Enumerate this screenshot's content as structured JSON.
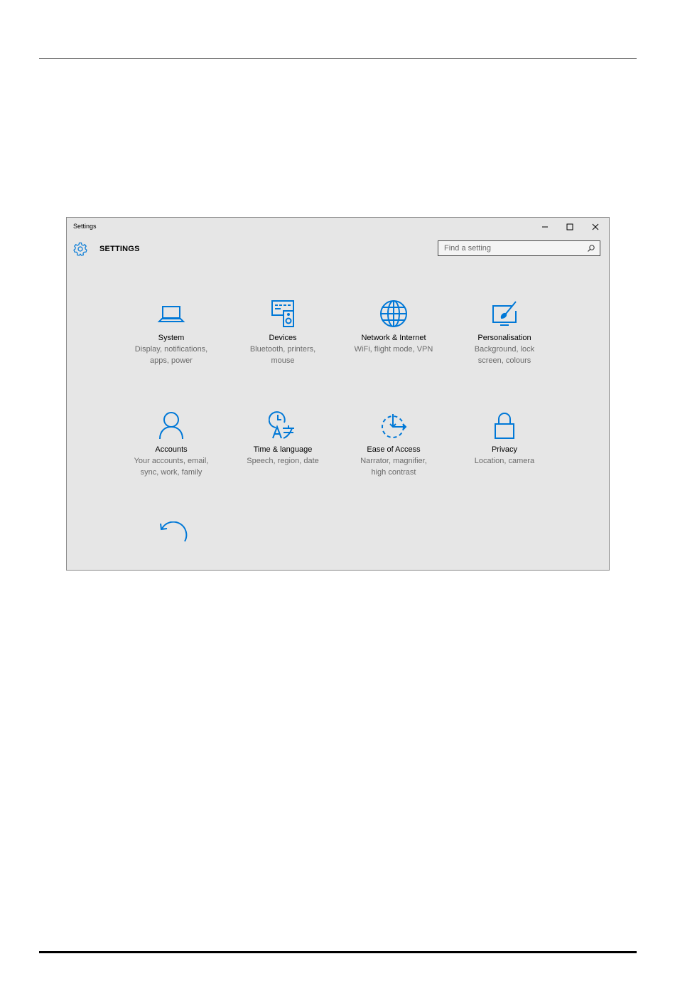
{
  "window": {
    "title": "Settings",
    "heading": "SETTINGS",
    "search": {
      "placeholder": "Find a setting",
      "value": ""
    }
  },
  "tiles": [
    {
      "title": "System",
      "desc1": "Display, notifications,",
      "desc2": "apps, power",
      "icon": "laptop-icon"
    },
    {
      "title": "Devices",
      "desc1": "Bluetooth, printers,",
      "desc2": "mouse",
      "icon": "devices-icon"
    },
    {
      "title": "Network & Internet",
      "desc1": "WiFi, flight mode, VPN",
      "desc2": "",
      "icon": "globe-icon"
    },
    {
      "title": "Personalisation",
      "desc1": "Background, lock",
      "desc2": "screen, colours",
      "icon": "paint-icon"
    },
    {
      "title": "Accounts",
      "desc1": "Your accounts, email,",
      "desc2": "sync, work, family",
      "icon": "person-icon"
    },
    {
      "title": "Time & language",
      "desc1": "Speech, region, date",
      "desc2": "",
      "icon": "time-language-icon"
    },
    {
      "title": "Ease of Access",
      "desc1": "Narrator, magnifier,",
      "desc2": "high contrast",
      "icon": "ease-of-access-icon"
    },
    {
      "title": "Privacy",
      "desc1": "Location, camera",
      "desc2": "",
      "icon": "lock-icon"
    }
  ],
  "accent": "#0078d7"
}
